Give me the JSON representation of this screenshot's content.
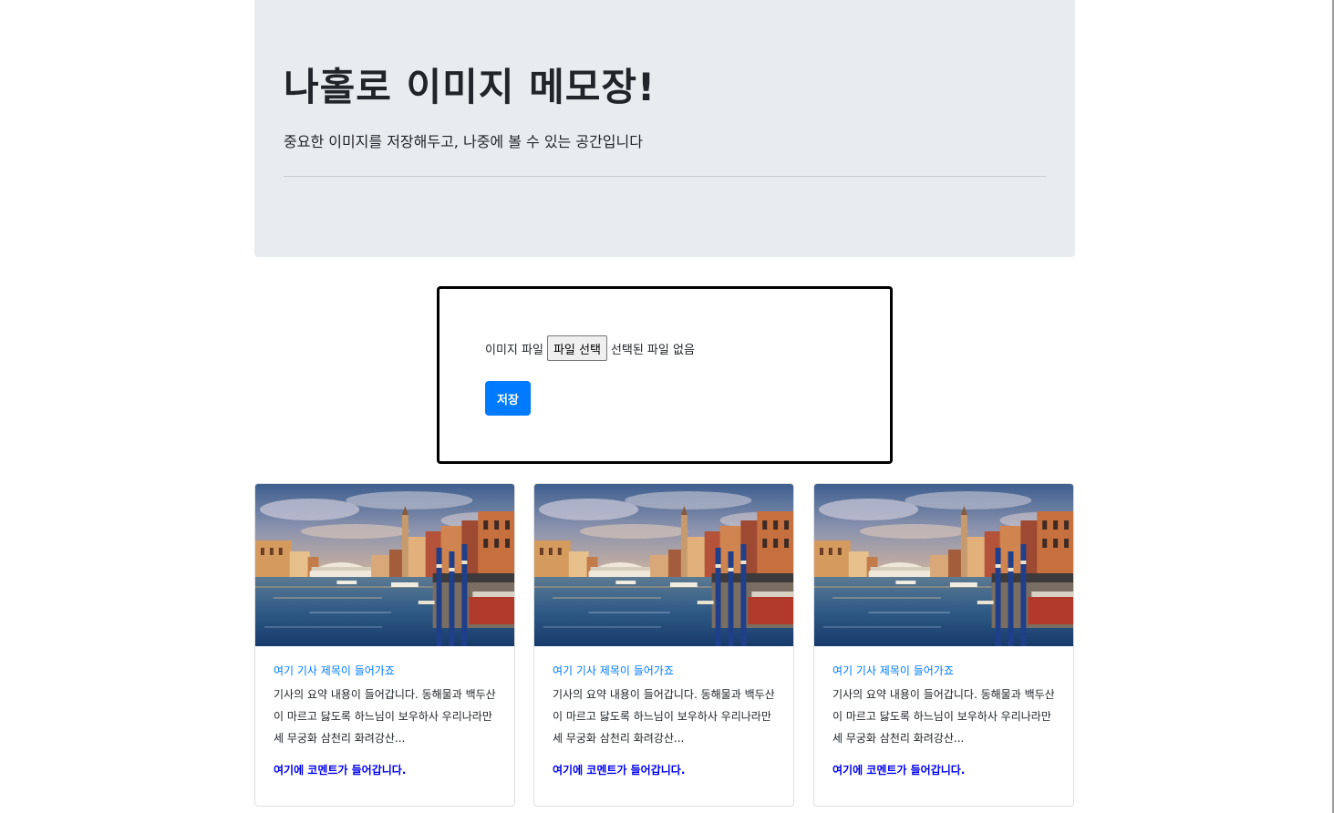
{
  "header": {
    "title": "나홀로 이미지 메모장!",
    "subtitle": "중요한 이미지를 저장해두고, 나중에 볼 수 있는 공간입니다"
  },
  "upload": {
    "file_label": "이미지 파일",
    "file_button_label": "파일 선택",
    "file_status": "선택된 파일 없음",
    "save_label": "저장"
  },
  "cards": [
    {
      "title": "여기 기사 제목이 들어가죠",
      "text": "기사의 요약 내용이 들어갑니다. 동해물과 백두산이 마르고 닳도록 하느님이 보우하사 우리나라만세 무궁화 삼천리 화려강산...",
      "comment": "여기에 코멘트가 들어갑니다."
    },
    {
      "title": "여기 기사 제목이 들어가죠",
      "text": "기사의 요약 내용이 들어갑니다. 동해물과 백두산이 마르고 닳도록 하느님이 보우하사 우리나라만세 무궁화 삼천리 화려강산...",
      "comment": "여기에 코멘트가 들어갑니다."
    },
    {
      "title": "여기 기사 제목이 들어가죠",
      "text": "기사의 요약 내용이 들어갑니다. 동해물과 백두산이 마르고 닳도록 하느님이 보우하사 우리나라만세 무궁화 삼천리 화려강산...",
      "comment": "여기에 코멘트가 들어갑니다."
    }
  ],
  "colors": {
    "jumbotron_bg": "#e9ecef",
    "primary": "#007bff",
    "comment_link": "#0000ee"
  }
}
